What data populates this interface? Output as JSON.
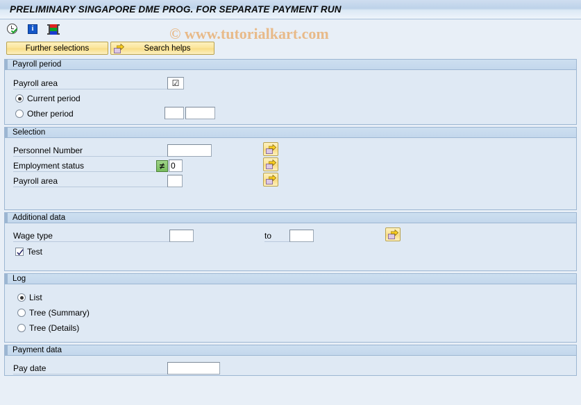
{
  "window": {
    "title": "PRELIMINARY SINGAPORE DME PROG. FOR SEPARATE PAYMENT RUN"
  },
  "watermark": {
    "text": "© www.tutorialkart.com"
  },
  "toolbar": {
    "items": [
      {
        "name": "execute-icon",
        "glyph": "clock-check"
      },
      {
        "name": "information-icon",
        "glyph": "i"
      },
      {
        "name": "variant-icon",
        "glyph": "variant-bars"
      }
    ]
  },
  "buttons": {
    "further_selections": "Further selections",
    "search_helps": "Search helps"
  },
  "sections": {
    "payroll_period": {
      "title": "Payroll period",
      "payroll_area_label": "Payroll area",
      "payroll_area_value": "☑",
      "current_period_label": "Current period",
      "current_period_selected": true,
      "other_period_label": "Other period",
      "other_period_selected": false,
      "other_period_value_1": "",
      "other_period_value_2": ""
    },
    "selection": {
      "title": "Selection",
      "rows": [
        {
          "label": "Personnel Number",
          "value": "",
          "has_operator": false,
          "multi_select_icon": "multiple-selection-icon"
        },
        {
          "label": "Employment status",
          "value": "0",
          "has_operator": true,
          "operator_symbol": "≠",
          "multi_select_icon": "multiple-selection-icon"
        },
        {
          "label": "Payroll area",
          "value": "",
          "has_operator": false,
          "multi_select_icon": "multiple-selection-icon"
        }
      ]
    },
    "additional_data": {
      "title": "Additional data",
      "wage_type_label": "Wage type",
      "wage_type_from": "",
      "to_label": "to",
      "wage_type_to": "",
      "test_label": "Test",
      "test_checked": true
    },
    "log": {
      "title": "Log",
      "options": [
        {
          "label": "List",
          "selected": true
        },
        {
          "label": "Tree (Summary)",
          "selected": false
        },
        {
          "label": "Tree (Details)",
          "selected": false
        }
      ]
    },
    "payment_data": {
      "title": "Payment data",
      "pay_date_label": "Pay date",
      "pay_date_value": ""
    }
  },
  "colors": {
    "title_bar": "#bdd2e9",
    "panel_bg": "#dfe9f4",
    "panel_border": "#9cb6d2",
    "button_yellow": "#fae292",
    "watermark": "#e8b884",
    "operator_green": "#78bd5d"
  }
}
